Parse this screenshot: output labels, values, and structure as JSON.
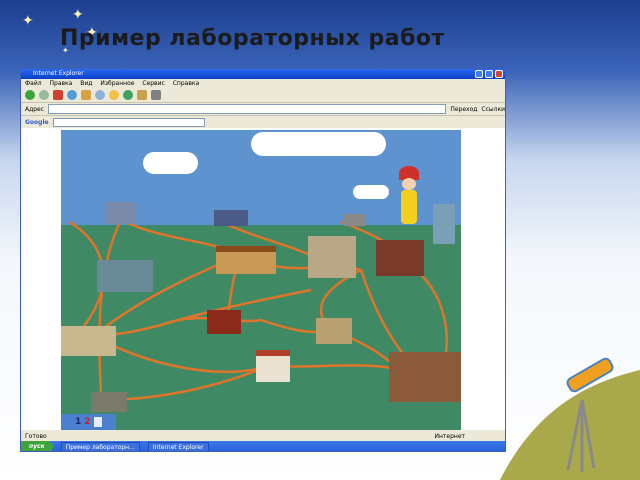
{
  "slide": {
    "title": "Пример лабораторных работ"
  },
  "colors": {
    "sky": "#5f93d0",
    "grass": "#3f8a64",
    "road": "#e0742a",
    "window_title": "#0a3fc8"
  },
  "browser": {
    "title": "Internet Explorer",
    "menu": [
      "Файл",
      "Правка",
      "Вид",
      "Избранное",
      "Сервис",
      "Справка"
    ],
    "address_label": "Адрес",
    "go_label": "Переход",
    "links_label": "Ссылки",
    "google_label": "Google",
    "status_text": "Готово",
    "zone_text": "Интернет"
  },
  "taskbar": {
    "start_label": "пуск",
    "tasks": [
      "Пример лабораторн...",
      "Internet Explorer"
    ],
    "clock": ""
  },
  "game": {
    "level_labels": [
      "1",
      "2"
    ],
    "character": "jester-icon"
  },
  "icons": [
    "back-icon",
    "forward-icon",
    "stop-icon",
    "refresh-icon",
    "home-icon",
    "search-icon",
    "favorites-icon",
    "history-icon",
    "mail-icon",
    "print-icon"
  ]
}
